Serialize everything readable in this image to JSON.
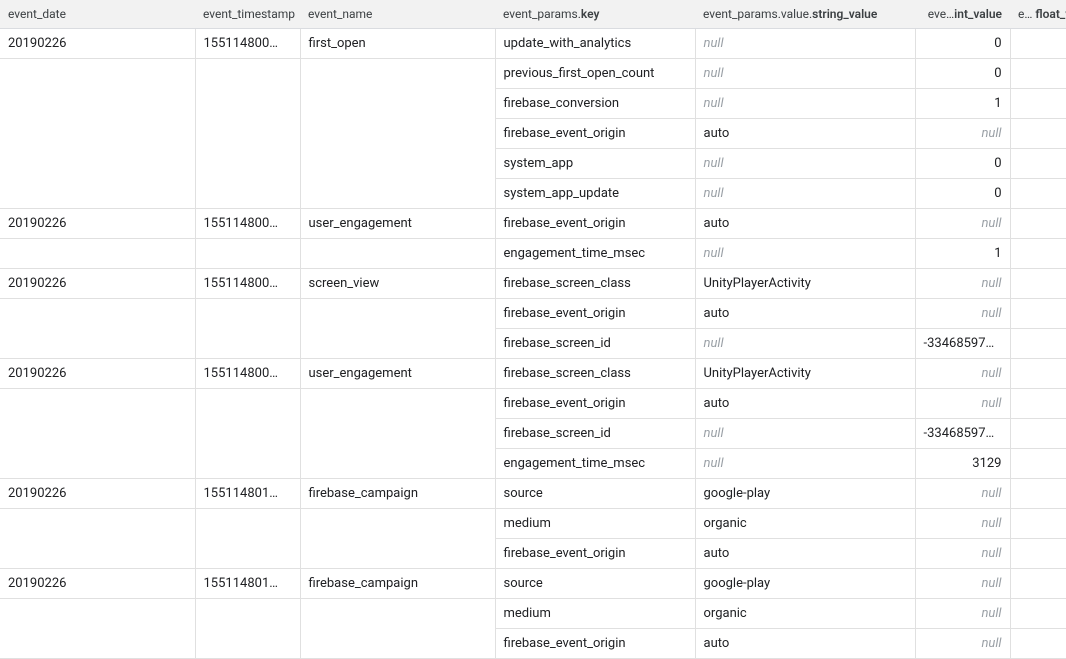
{
  "headers": {
    "event_date": "event_date",
    "event_timestamp": "event_timestamp",
    "event_name": "event_name",
    "event_params_key_prefix": "event_params.",
    "event_params_key_bold": "key",
    "string_value_prefix": "event_params.value.",
    "string_value_bold": "string_value",
    "int_value_prefix": "eve…",
    "int_value_bold": "int_value",
    "float_value_prefix": "e… ",
    "float_value_bold": "float_v"
  },
  "null_label": "null",
  "rows": [
    {
      "event_date": "20190226",
      "event_timestamp": "155114800…",
      "event_name": "first_open",
      "params": [
        {
          "key": "update_with_analytics",
          "string_value": null,
          "int_value": "0",
          "float_value": ""
        },
        {
          "key": "previous_first_open_count",
          "string_value": null,
          "int_value": "0",
          "float_value": ""
        },
        {
          "key": "firebase_conversion",
          "string_value": null,
          "int_value": "1",
          "float_value": ""
        },
        {
          "key": "firebase_event_origin",
          "string_value": "auto",
          "int_value": null,
          "float_value": ""
        },
        {
          "key": "system_app",
          "string_value": null,
          "int_value": "0",
          "float_value": ""
        },
        {
          "key": "system_app_update",
          "string_value": null,
          "int_value": "0",
          "float_value": ""
        }
      ]
    },
    {
      "event_date": "20190226",
      "event_timestamp": "155114800…",
      "event_name": "user_engagement",
      "params": [
        {
          "key": "firebase_event_origin",
          "string_value": "auto",
          "int_value": null,
          "float_value": ""
        },
        {
          "key": "engagement_time_msec",
          "string_value": null,
          "int_value": "1",
          "float_value": ""
        }
      ]
    },
    {
      "event_date": "20190226",
      "event_timestamp": "155114800…",
      "event_name": "screen_view",
      "params": [
        {
          "key": "firebase_screen_class",
          "string_value": "UnityPlayerActivity",
          "int_value": null,
          "float_value": ""
        },
        {
          "key": "firebase_event_origin",
          "string_value": "auto",
          "int_value": null,
          "float_value": ""
        },
        {
          "key": "firebase_screen_id",
          "string_value": null,
          "int_value": "-334685975…",
          "float_value": ""
        }
      ]
    },
    {
      "event_date": "20190226",
      "event_timestamp": "155114800…",
      "event_name": "user_engagement",
      "params": [
        {
          "key": "firebase_screen_class",
          "string_value": "UnityPlayerActivity",
          "int_value": null,
          "float_value": ""
        },
        {
          "key": "firebase_event_origin",
          "string_value": "auto",
          "int_value": null,
          "float_value": ""
        },
        {
          "key": "firebase_screen_id",
          "string_value": null,
          "int_value": "-334685975…",
          "float_value": ""
        },
        {
          "key": "engagement_time_msec",
          "string_value": null,
          "int_value": "3129",
          "float_value": ""
        }
      ]
    },
    {
      "event_date": "20190226",
      "event_timestamp": "155114801…",
      "event_name": "firebase_campaign",
      "params": [
        {
          "key": "source",
          "string_value": "google-play",
          "int_value": null,
          "float_value": ""
        },
        {
          "key": "medium",
          "string_value": "organic",
          "int_value": null,
          "float_value": ""
        },
        {
          "key": "firebase_event_origin",
          "string_value": "auto",
          "int_value": null,
          "float_value": ""
        }
      ]
    },
    {
      "event_date": "20190226",
      "event_timestamp": "155114801…",
      "event_name": "firebase_campaign",
      "params": [
        {
          "key": "source",
          "string_value": "google-play",
          "int_value": null,
          "float_value": ""
        },
        {
          "key": "medium",
          "string_value": "organic",
          "int_value": null,
          "float_value": ""
        },
        {
          "key": "firebase_event_origin",
          "string_value": "auto",
          "int_value": null,
          "float_value": ""
        }
      ]
    }
  ]
}
